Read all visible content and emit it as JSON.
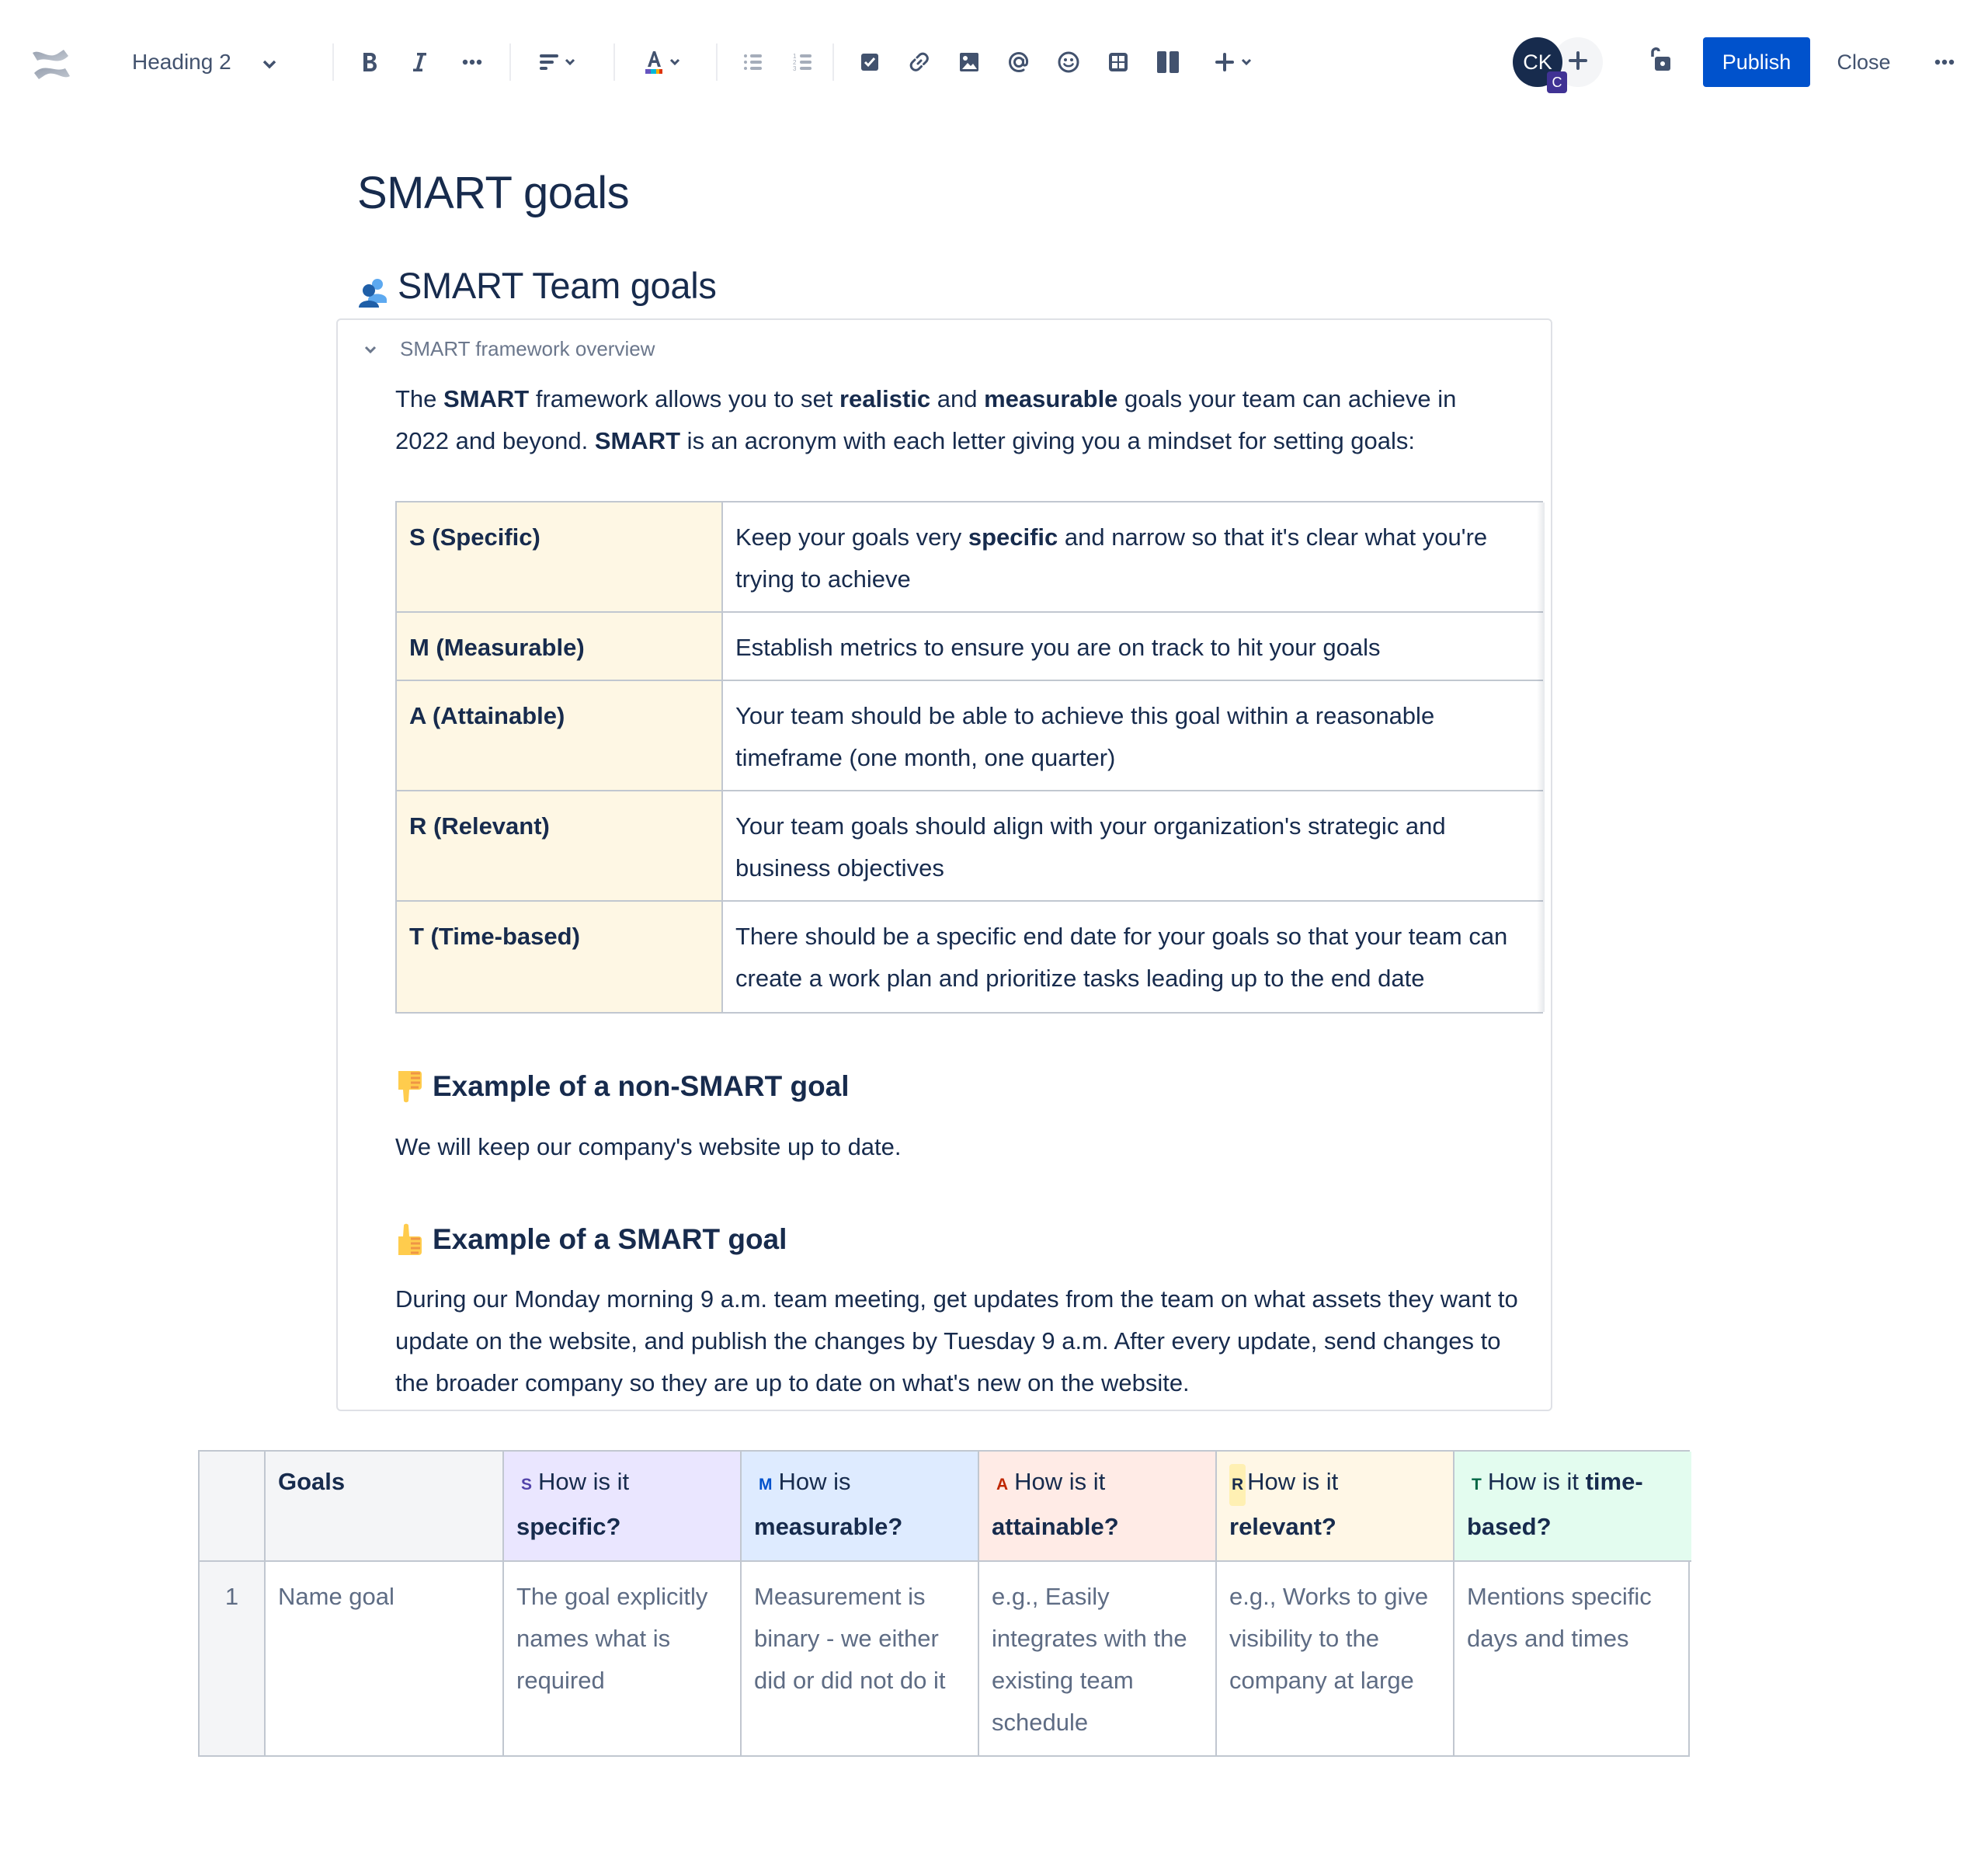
{
  "toolbar": {
    "logo": "confluence-logo-icon",
    "text_style": "Heading 2",
    "buttons": [
      {
        "name": "bold",
        "icon": "bold-icon"
      },
      {
        "name": "italic",
        "icon": "italic-icon"
      },
      {
        "name": "more-formatting",
        "icon": "more-icon"
      },
      {
        "name": "alignment",
        "icon": "align-left-icon"
      },
      {
        "name": "text-color",
        "icon": "text-color-icon"
      },
      {
        "name": "bullet-list",
        "icon": "bullet-list-icon"
      },
      {
        "name": "numbered-list",
        "icon": "numbered-list-icon"
      },
      {
        "name": "action-item",
        "icon": "checkbox-icon"
      },
      {
        "name": "link",
        "icon": "link-icon"
      },
      {
        "name": "image",
        "icon": "image-icon"
      },
      {
        "name": "mention",
        "icon": "mention-icon"
      },
      {
        "name": "emoji",
        "icon": "emoji-icon"
      },
      {
        "name": "table",
        "icon": "table-icon"
      },
      {
        "name": "layouts",
        "icon": "layout-icon"
      },
      {
        "name": "insert",
        "icon": "plus-icon"
      }
    ],
    "avatar_initials": "CK",
    "avatar_badge": "C",
    "publish_label": "Publish",
    "close_label": "Close"
  },
  "page": {
    "title": "SMART goals",
    "section_heading": "SMART Team goals",
    "expand_title": "SMART framework overview",
    "intro": {
      "p1_a": "The ",
      "p1_b": "SMART",
      "p1_c": " framework allows you to set ",
      "p1_d": "realistic",
      "p1_e": " and ",
      "p1_f": "measurable",
      "p1_g": " goals your team can achieve in",
      "p2_a": "2022 and beyond. ",
      "p2_b": "SMART",
      "p2_c": " is an acronym with each letter giving you a mindset for setting goals:"
    },
    "framework_table": [
      {
        "key": "S (Specific)",
        "value_a": "Keep your goals very ",
        "value_b": "specific",
        "value_c": " and narrow so that it's clear what you're trying to achieve"
      },
      {
        "key": "M (Measurable)",
        "value_a": "Establish metrics to ensure you are on track to hit your goals",
        "value_b": "",
        "value_c": ""
      },
      {
        "key": "A (Attainable)",
        "value_a": "Your team should be able to achieve this goal within a reasonable timeframe (one month, one quarter)",
        "value_b": "",
        "value_c": ""
      },
      {
        "key": "R (Relevant)",
        "value_a": "Your team goals should align with your organization's strategic and business objectives",
        "value_b": "",
        "value_c": ""
      },
      {
        "key": "T (Time-based)",
        "value_a": "There should be a specific end date for your goals so that your team can create a work plan and prioritize tasks leading up to the end date",
        "value_b": "",
        "value_c": ""
      }
    ],
    "non_smart": {
      "heading": "Example of a non-SMART goal",
      "text": "We will keep our company's website up to date."
    },
    "smart": {
      "heading": "Example of a SMART goal",
      "text": "During our Monday morning 9 a.m. team meeting, get updates from the team on what assets they want to update on the website, and publish the changes by Tuesday 9 a.m. After every update, send changes to the broader company so they are up to date on what's new on the website."
    }
  },
  "goals_table": {
    "headers": [
      {
        "letter": "",
        "plain": "",
        "bold": ""
      },
      {
        "letter": "",
        "plain": "",
        "bold": "Goals"
      },
      {
        "letter": "S",
        "plain": "How is it ",
        "bold": "specific?"
      },
      {
        "letter": "M",
        "plain": "How is ",
        "bold": "measurable?"
      },
      {
        "letter": "A",
        "plain": "How is it ",
        "bold": "attainable?"
      },
      {
        "letter": "R",
        "plain": "How is it ",
        "bold": "relevant?"
      },
      {
        "letter": "T",
        "plain": "How is it ",
        "bold": "time-based?"
      }
    ],
    "rows": [
      {
        "number": "1",
        "cells": [
          "Name goal",
          "The goal explicitly names what is required",
          "Measurement is binary - we either did or did not do it",
          "e.g., Easily integrates with the existing team schedule",
          "e.g., Works to give visibility to the company at large",
          "Mentions specific days and times"
        ]
      }
    ]
  },
  "colors": {
    "primary": "#0052CC",
    "text": "#172B4D",
    "subtle_text": "#5E6C84",
    "s": "#EAE6FF",
    "m": "#DEEBFF",
    "a": "#FFEBE6",
    "r": "#FFF7E6",
    "t": "#E3FCEF"
  }
}
